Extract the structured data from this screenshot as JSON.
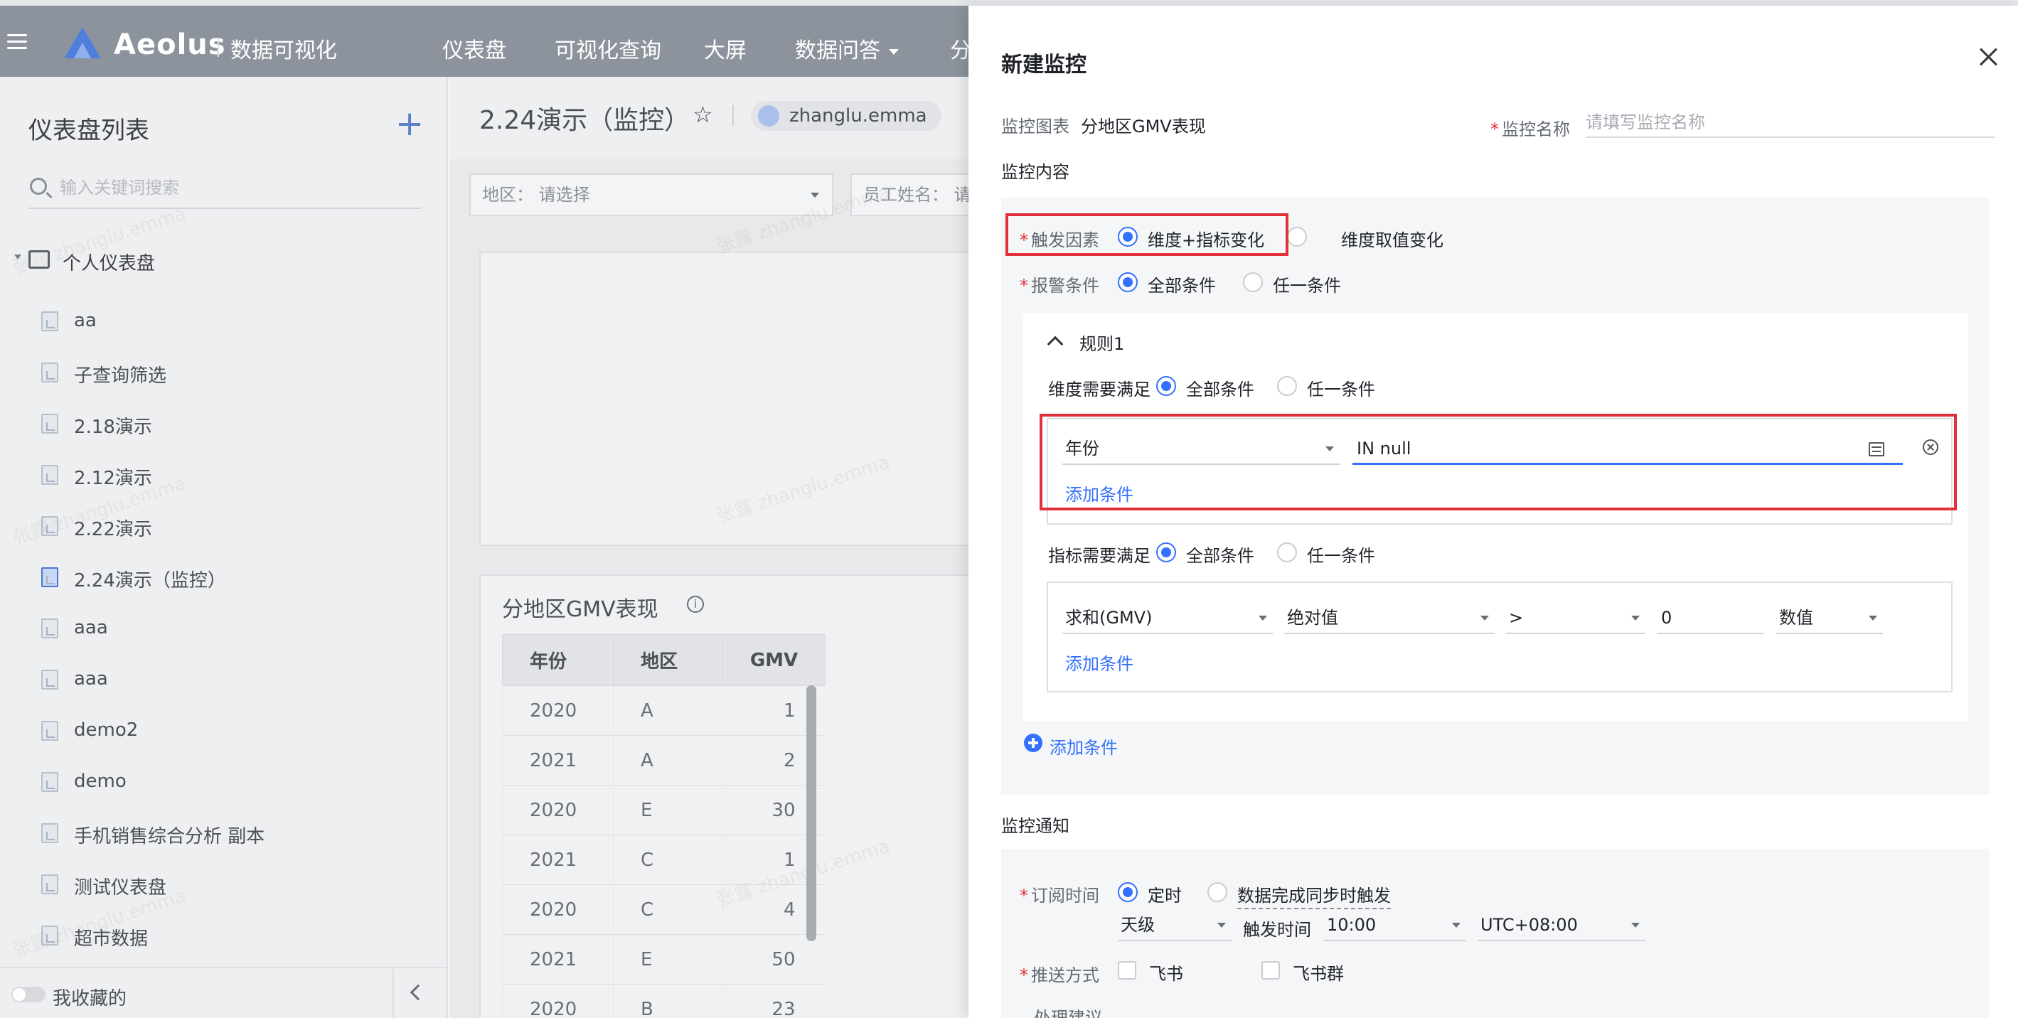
{
  "topnav": {
    "brand": "Aeolus",
    "subtitle": "数据可视化",
    "items": [
      {
        "label": "仪表盘",
        "has_caret": false
      },
      {
        "label": "可视化查询",
        "has_caret": false
      },
      {
        "label": "大屏",
        "has_caret": false
      },
      {
        "label": "数据问答",
        "has_caret": true
      },
      {
        "label": "分",
        "has_caret": false
      }
    ]
  },
  "sidebar": {
    "title": "仪表盘列表",
    "add_symbol": "+",
    "search_placeholder": "输入关键词搜索",
    "group_label": "个人仪表盘",
    "items": [
      {
        "label": "aa",
        "active": false
      },
      {
        "label": "子查询筛选",
        "active": false
      },
      {
        "label": "2.18演示",
        "active": false
      },
      {
        "label": "2.12演示",
        "active": false
      },
      {
        "label": "2.22演示",
        "active": false
      },
      {
        "label": "2.24演示（监控）",
        "active": true
      },
      {
        "label": "aaa",
        "active": false
      },
      {
        "label": "aaa",
        "active": false
      },
      {
        "label": "demo2",
        "active": false
      },
      {
        "label": "demo",
        "active": false
      },
      {
        "label": "手机销售综合分析 副本",
        "active": false
      },
      {
        "label": "测试仪表盘",
        "active": false
      },
      {
        "label": "超市数据",
        "active": false
      }
    ],
    "footer_label": "我收藏的"
  },
  "dashboard": {
    "title": "2.24演示（监控）",
    "star": "☆",
    "owner": "zhanglu.emma",
    "filters": [
      {
        "label": "地区：",
        "placeholder": "请选择"
      },
      {
        "label": "员工姓名：",
        "placeholder": "请"
      }
    ],
    "gmv_card": {
      "title": "分地区GMV表现",
      "info": "i",
      "columns": [
        "年份",
        "地区",
        "GMV"
      ],
      "rows": [
        [
          "2020",
          "A",
          "1"
        ],
        [
          "2021",
          "A",
          "2"
        ],
        [
          "2020",
          "E",
          "30"
        ],
        [
          "2021",
          "C",
          "1"
        ],
        [
          "2020",
          "C",
          "4"
        ],
        [
          "2021",
          "E",
          "50"
        ],
        [
          "2020",
          "B",
          "23"
        ]
      ]
    },
    "watermark": "张露 zhanglu.emma"
  },
  "drawer": {
    "title": "新建监控",
    "chart_label": "监控图表",
    "chart_value": "分地区GMV表现",
    "name_label": "监控名称",
    "name_placeholder": "请填写监控名称",
    "content_section": "监控内容",
    "trigger": {
      "label": "触发因素",
      "options": [
        "维度+指标变化",
        "维度取值变化"
      ],
      "selected": 0
    },
    "alarm": {
      "label": "报警条件",
      "options": [
        "全部条件",
        "任一条件"
      ],
      "selected": 0
    },
    "rule": {
      "title": "规则1",
      "dim_label": "维度需要满足",
      "dim_options": [
        "全部条件",
        "任一条件"
      ],
      "dim_selected": 0,
      "dim_field": "年份",
      "dim_value": "IN null",
      "add_condition": "添加条件",
      "metric_label": "指标需要满足",
      "metric_options": [
        "全部条件",
        "任一条件"
      ],
      "metric_selected": 0,
      "metric_field": "求和(GMV)",
      "metric_mode": "绝对值",
      "metric_op": ">",
      "metric_value": "0",
      "metric_unit": "数值"
    },
    "add_condition": "添加条件",
    "notify_section": "监控通知",
    "subscribe": {
      "label": "订阅时间",
      "options": [
        "定时",
        "数据完成同步时触发"
      ],
      "selected": 0,
      "frequency": "天级",
      "trigger_time_label": "触发时间",
      "trigger_time": "10:00",
      "timezone": "UTC+08:00"
    },
    "push": {
      "label": "推送方式",
      "options": [
        "飞书",
        "飞书群"
      ]
    },
    "advice_label": "处理建议"
  },
  "colors": {
    "nav_bg": "#8d939c",
    "primary": "#3370ff",
    "required": "#e0303a",
    "highlight": "#e0303a"
  }
}
